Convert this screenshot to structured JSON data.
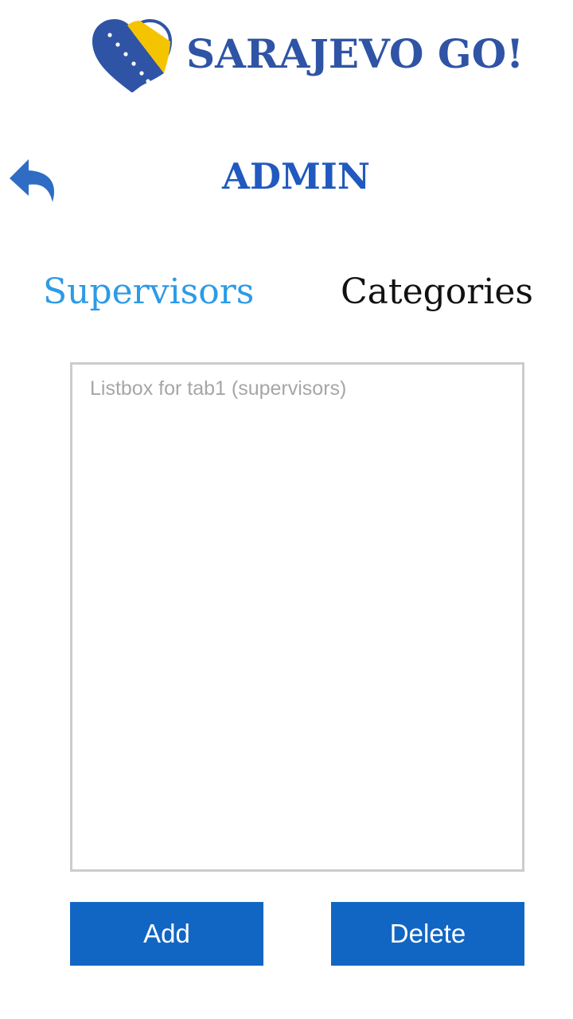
{
  "logo": {
    "text": "SARAJEVO GO!",
    "icon": "heart-flag-icon"
  },
  "header": {
    "back_icon": "back-arrow-icon",
    "title": "ADMIN"
  },
  "tabs": [
    {
      "label": "Supervisors",
      "active": true
    },
    {
      "label": "Categories",
      "active": false
    }
  ],
  "listbox": {
    "placeholder": "Listbox for tab1 (supervisors)"
  },
  "actions": {
    "add_label": "Add",
    "delete_label": "Delete"
  },
  "colors": {
    "brand_blue": "#2f54a5",
    "title_blue": "#2059bf",
    "active_tab": "#2d9be6",
    "button_blue": "#1266c3",
    "flag_yellow": "#f5c400"
  }
}
